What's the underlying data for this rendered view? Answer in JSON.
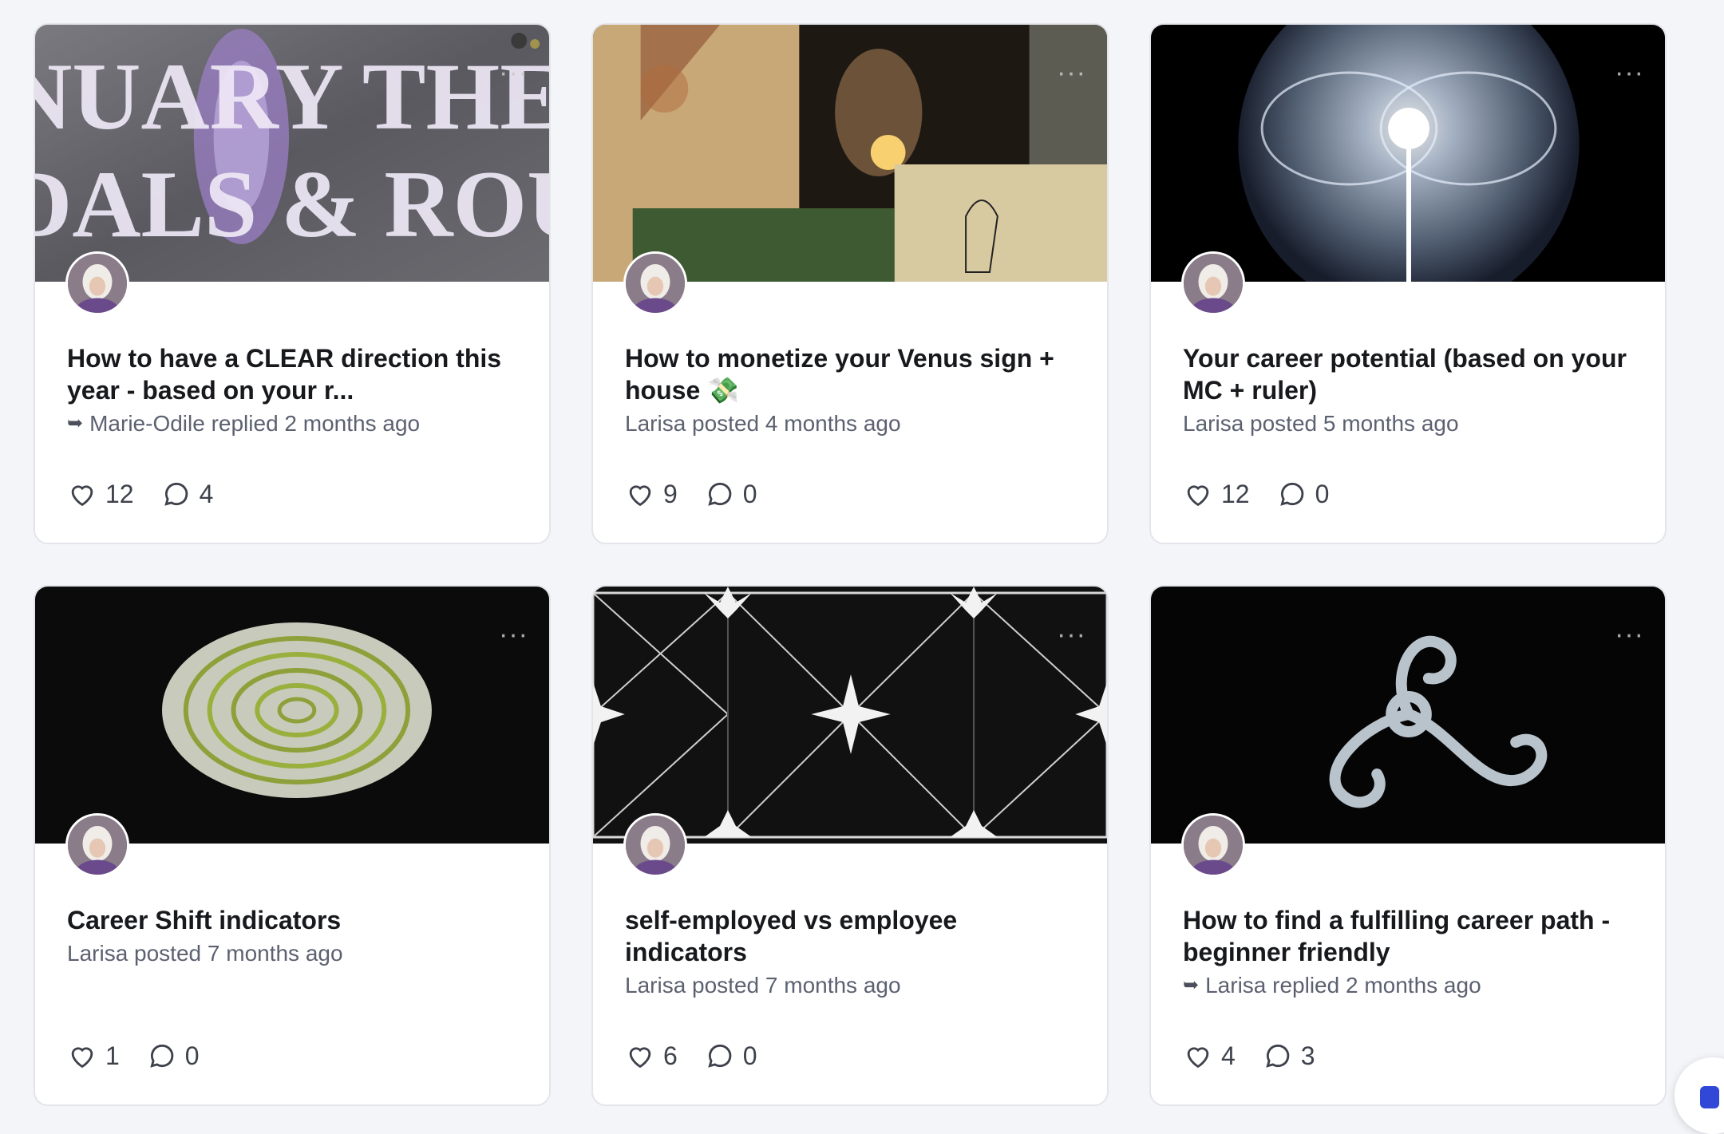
{
  "posts": [
    {
      "cover_text_line1": "NUARY THEM",
      "cover_text_line2": "DALS & ROUTI",
      "title": "How to have a CLEAR direction this year - based on your r...",
      "meta": "Marie-Odile replied 2 months ago",
      "is_reply": true,
      "likes": "12",
      "comments": "4"
    },
    {
      "title": "How to monetize your Venus sign + house 💸",
      "meta": "Larisa posted 4 months ago",
      "is_reply": false,
      "likes": "9",
      "comments": "0"
    },
    {
      "title": "Your career potential (based on your MC + ruler)",
      "meta": "Larisa posted 5 months ago",
      "is_reply": false,
      "likes": "12",
      "comments": "0"
    },
    {
      "title": "Career Shift indicators",
      "meta": "Larisa posted 7 months ago",
      "is_reply": false,
      "likes": "1",
      "comments": "0"
    },
    {
      "title": "self-employed vs employee indicators",
      "meta": "Larisa posted 7 months ago",
      "is_reply": false,
      "likes": "6",
      "comments": "0"
    },
    {
      "title": "How to find a fulfilling career path - beginner friendly",
      "meta": "Larisa replied 2 months ago",
      "is_reply": true,
      "likes": "4",
      "comments": "3"
    }
  ],
  "icons": {
    "more": "more-horizontal-icon",
    "like": "heart-icon",
    "comment": "comment-bubble-icon",
    "reply": "reply-arrow-icon"
  },
  "colors": {
    "page_background": "#f4f5f8",
    "card_border": "#e3e5ea",
    "title_text": "#17191d",
    "meta_text": "#5b6170",
    "chat_accent": "#3047d8"
  }
}
